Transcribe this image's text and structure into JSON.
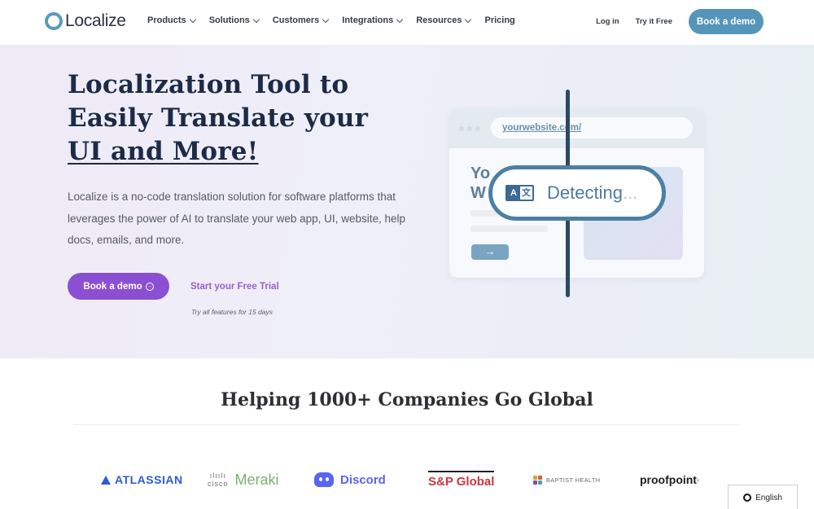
{
  "nav": {
    "brand": "Localize",
    "items": [
      {
        "label": "Products",
        "has_dropdown": true
      },
      {
        "label": "Solutions",
        "has_dropdown": true
      },
      {
        "label": "Customers",
        "has_dropdown": true
      },
      {
        "label": "Integrations",
        "has_dropdown": true
      },
      {
        "label": "Resources",
        "has_dropdown": true
      },
      {
        "label": "Pricing",
        "has_dropdown": false
      }
    ],
    "login": "Log in",
    "try_free": "Try it Free",
    "cta": "Book a demo"
  },
  "hero": {
    "title_line1": "Localization Tool to",
    "title_line2": "Easily Translate your",
    "title_line3": "UI and More!",
    "description": "Localize is a no-code translation solution for software platforms that leverages the power of AI to translate your web app, UI, website, help docs, emails, and more.",
    "primary_button": "Book a demo",
    "secondary_link": "Start your Free Trial",
    "trial_note": "Try all features for 15 days"
  },
  "illustration": {
    "url": "yourwebsite.com/",
    "heading_fragment_1": "Yo",
    "heading_fragment_2": "W",
    "translate_icon_a": "A",
    "translate_icon_b": "文",
    "status": "Detecting",
    "status_dots": "...",
    "arrow": "→"
  },
  "companies": {
    "title": "Helping 1000+ Companies Go Global",
    "logos": [
      {
        "name": "ATLASSIAN"
      },
      {
        "name": "Cisco Meraki",
        "part1": "cisco",
        "part2": "Meraki"
      },
      {
        "name": "Discord"
      },
      {
        "name": "S&P Global"
      },
      {
        "name": "BAPTIST HEALTH"
      },
      {
        "name": "proofpoint"
      }
    ]
  },
  "language_selector": {
    "label": "English"
  },
  "colors": {
    "brand_blue": "#5495b9",
    "cta_purple": "#8b4fd3",
    "heading_navy": "#1c2b47"
  }
}
